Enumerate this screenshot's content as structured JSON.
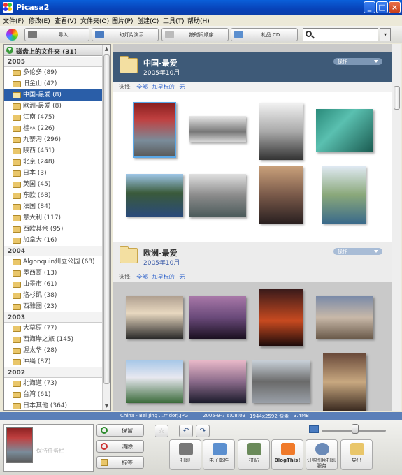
{
  "app": {
    "title": "Picasa2"
  },
  "menu": [
    "文件(F)",
    "修改(E)",
    "查看(V)",
    "文件夹(O)",
    "图片(P)",
    "创建(C)",
    "工具(T)",
    "帮助(H)"
  ],
  "toolbar": {
    "import": "导入",
    "slideshow": "幻灯片演示",
    "timeline": "按时间顺序",
    "giftcd": "礼品 CD"
  },
  "search": {
    "value": ""
  },
  "sidebar": {
    "header": "磁盘上的文件夹 (31)",
    "groups": [
      {
        "year": "2005",
        "items": [
          "多伦多 (89)",
          "旧金山 (42)",
          "中国-最爱 (8)",
          "欧洲-最爱 (8)",
          "江南 (475)",
          "桂林 (226)",
          "九寨沟 (296)",
          "陕西 (451)",
          "北京 (248)",
          "日本 (3)",
          "英国 (45)",
          "东欧 (68)",
          "法国 (84)",
          "意大利 (117)",
          "西欧其余 (95)",
          "加拿大 (16)"
        ]
      },
      {
        "year": "2004",
        "items": [
          "Algonquin州立公园 (68)",
          "墨西哥 (13)",
          "山景市 (61)",
          "洛杉矶 (38)",
          "西雅图 (23)"
        ]
      },
      {
        "year": "2003",
        "items": [
          "大草原 (77)",
          "西海岸之旅 (145)",
          "渥太华 (28)",
          "冲绳 (87)"
        ]
      },
      {
        "year": "2002",
        "items": [
          "北海道 (73)",
          "台湾 (61)",
          "日本其他 (364)"
        ]
      }
    ]
  },
  "albums": [
    {
      "title": "中国-最爱",
      "date": "2005年10月",
      "ops": "操作",
      "select_label": "选择:",
      "select_all": "全部",
      "select_starred": "加星标的",
      "select_none": "无"
    },
    {
      "title": "欧洲-最爱",
      "date": "2005年10月",
      "ops": "操作",
      "select_label": "选择:",
      "select_all": "全部",
      "select_starred": "加星标的",
      "select_none": "无"
    }
  ],
  "status": {
    "file": "China - Bei Jing ...rridorj.JPG",
    "datetime": "2005-9-7 6:08:09",
    "dims": "1944x2592 像素",
    "size": "3.4MB"
  },
  "tray": {
    "hint": "保持任务栏"
  },
  "actions": {
    "hold": "保留",
    "clear": "清除",
    "label": "标签"
  },
  "bottom_buttons": [
    "打印",
    "电子邮件",
    "拼贴",
    "BlogThis!",
    "订购图片打印服务",
    "导出"
  ],
  "colors": {
    "title_bar": "#0842b8",
    "selection": "#2a5ea8",
    "album_header_dark": "#3e5a78",
    "status_bar": "#5a7fb8"
  }
}
